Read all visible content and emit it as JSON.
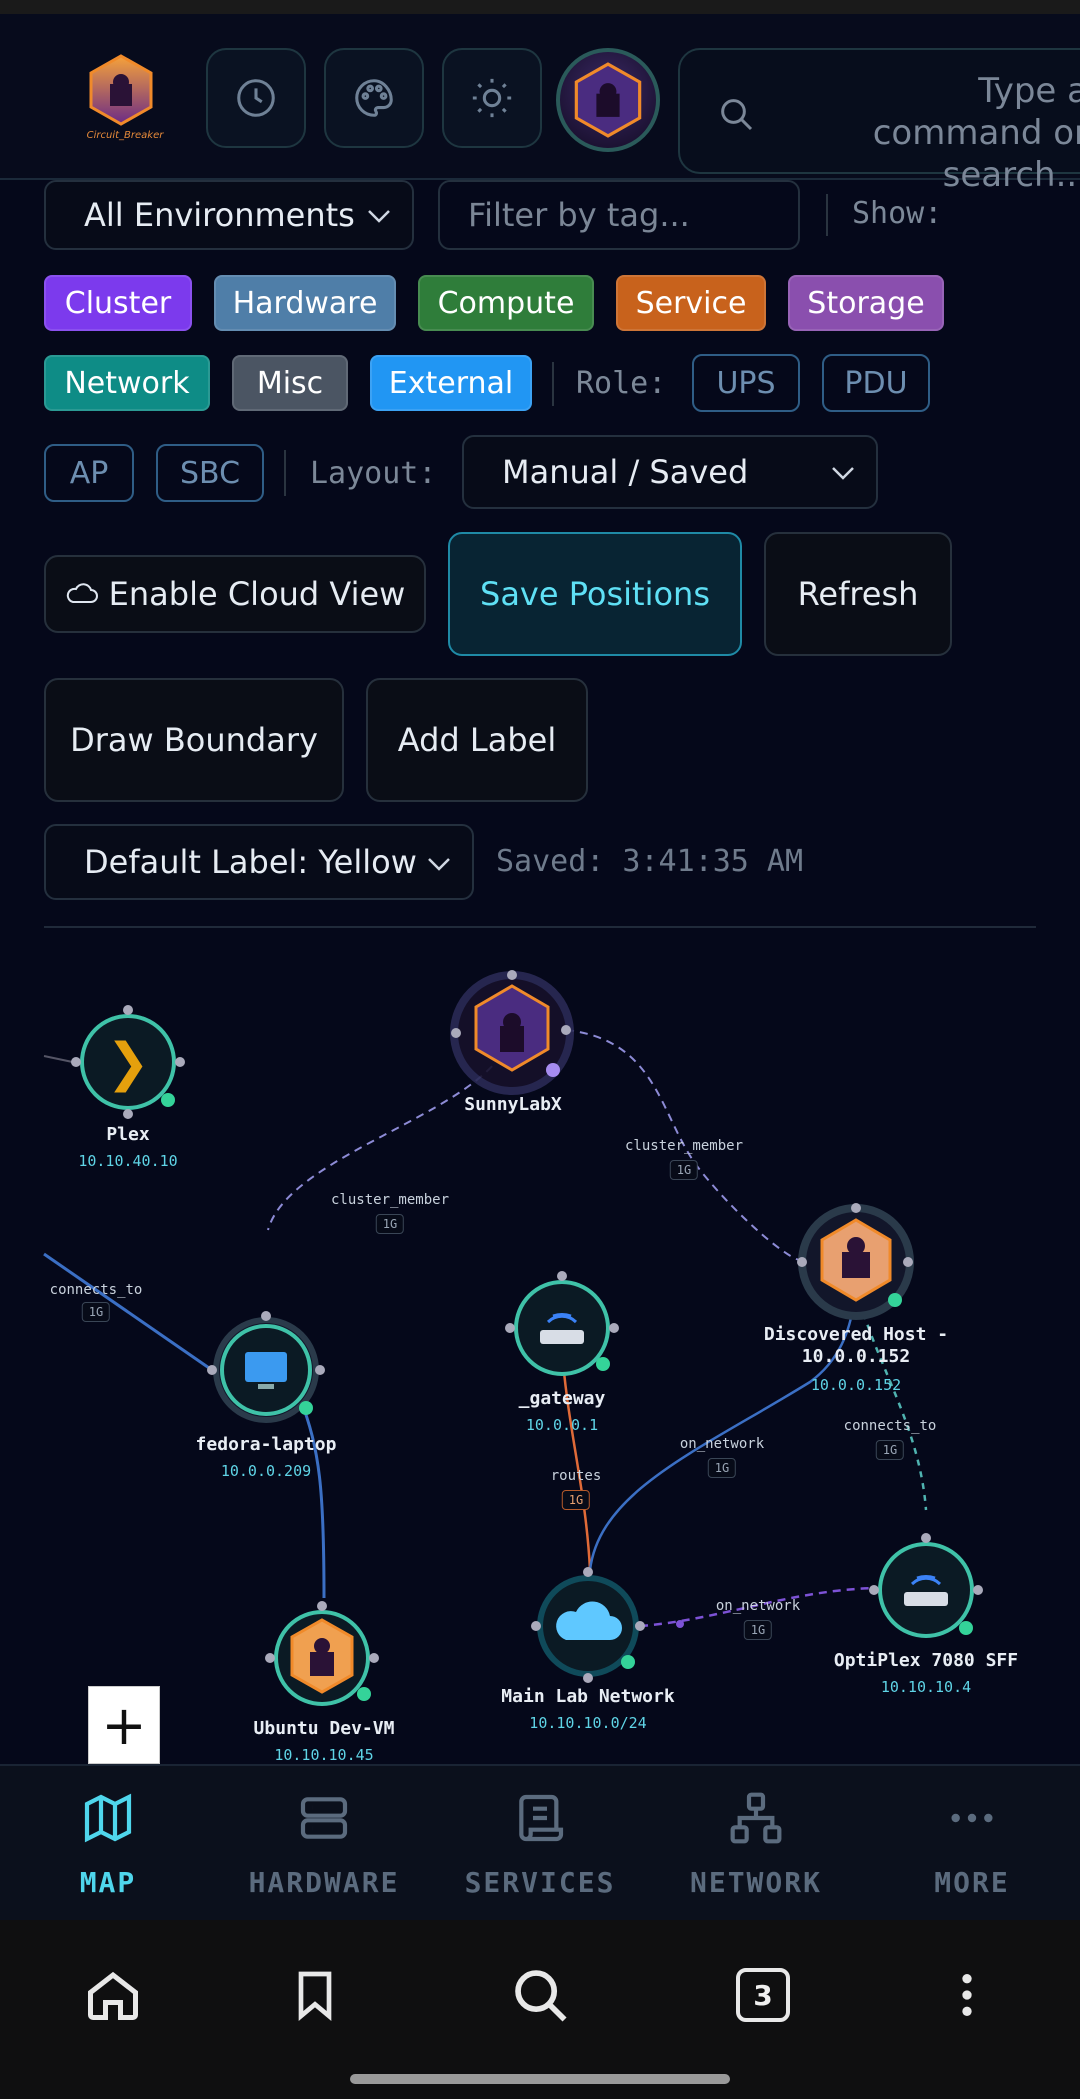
{
  "header": {
    "logo_text": "Circuit_Breaker",
    "search_placeholder": "Type a command or search..."
  },
  "filters": {
    "environment": "All Environments",
    "tag_placeholder": "Filter by tag...",
    "show_label": "Show:",
    "chips": [
      {
        "label": "Cluster",
        "color": "#7c3aed"
      },
      {
        "label": "Hardware",
        "color": "#4f7ea8"
      },
      {
        "label": "Compute",
        "color": "#2f7d3a"
      },
      {
        "label": "Service",
        "color": "#c8621c"
      },
      {
        "label": "Storage",
        "color": "#8a4fae"
      },
      {
        "label": "Network",
        "color": "#0e8c86"
      },
      {
        "label": "Misc",
        "color": "#4b5563"
      },
      {
        "label": "External",
        "color": "#2196f3"
      }
    ],
    "role_label": "Role:",
    "roles": [
      "UPS",
      "PDU",
      "AP",
      "SBC"
    ],
    "layout_label": "Layout:",
    "layout_value": "Manual / Saved"
  },
  "actions": {
    "cloud_view": "Enable Cloud View",
    "save_positions": "Save Positions",
    "refresh": "Refresh",
    "draw_boundary": "Draw Boundary",
    "add_label": "Add Label",
    "default_label": "Default Label: Yellow",
    "saved_status": "Saved: 3:41:35 AM"
  },
  "map": {
    "nodes": [
      {
        "id": "plex",
        "name": "Plex",
        "ip": "10.10.40.10"
      },
      {
        "id": "sunnylabx",
        "name": "SunnyLabX",
        "ip": ""
      },
      {
        "id": "discovered",
        "name": "Discovered Host -\n10.0.0.152",
        "ip": "10.0.0.152"
      },
      {
        "id": "gateway",
        "name": "_gateway",
        "ip": "10.0.0.1"
      },
      {
        "id": "fedora",
        "name": "fedora-laptop",
        "ip": "10.0.0.209"
      },
      {
        "id": "ubuntu",
        "name": "Ubuntu Dev-VM",
        "ip": "10.10.10.45"
      },
      {
        "id": "mainlab",
        "name": "Main Lab Network",
        "ip": "10.10.10.0/24"
      },
      {
        "id": "optiplex",
        "name": "OptiPlex 7080 SFF",
        "ip": "10.10.10.4"
      }
    ],
    "edges": [
      {
        "label": "cluster_member",
        "speed": "1G"
      },
      {
        "label": "cluster_member",
        "speed": "1G"
      },
      {
        "label": "connects_to",
        "speed": "1G"
      },
      {
        "label": "routes",
        "speed": "1G"
      },
      {
        "label": "on_network",
        "speed": "1G"
      },
      {
        "label": "connects_to",
        "speed": "1G"
      },
      {
        "label": "on_network",
        "speed": "1G"
      }
    ],
    "zoom_in": "+"
  },
  "nav": {
    "items": [
      "MAP",
      "HARDWARE",
      "SERVICES",
      "NETWORK",
      "MORE"
    ],
    "active": "MAP"
  },
  "browser": {
    "tab_count": "3"
  }
}
